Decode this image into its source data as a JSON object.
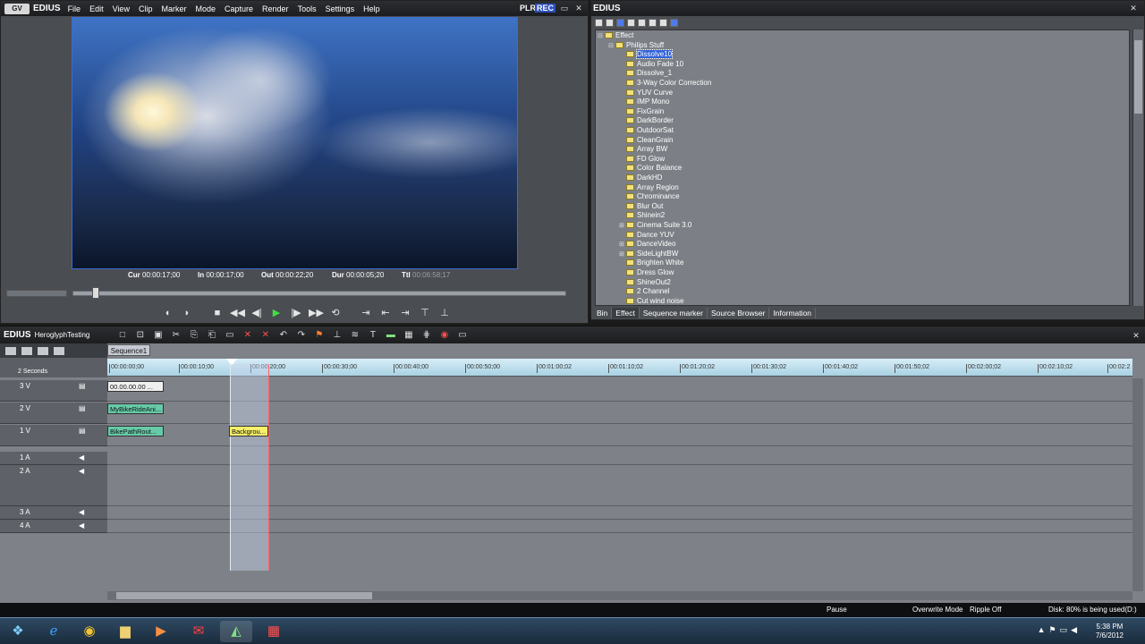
{
  "player": {
    "app_name": "EDIUS",
    "menu": [
      "File",
      "Edit",
      "View",
      "Clip",
      "Marker",
      "Mode",
      "Capture",
      "Render",
      "Tools",
      "Settings",
      "Help"
    ],
    "plr": "PLR",
    "rec": "REC",
    "timecodes": {
      "cur_label": "Cur",
      "cur": "00:00:17;00",
      "in_label": "In",
      "in": "00:00:17;00",
      "out_label": "Out",
      "out": "00:00:22;20",
      "dur_label": "Dur",
      "dur": "00:00:05;20",
      "ttl_label": "Ttl",
      "ttl": "00:06:58;17"
    },
    "scrub_position": 0.04
  },
  "effect_panel": {
    "title": "EDIUS",
    "tree": [
      {
        "label": "Effect",
        "level": 0,
        "expander": "minus"
      },
      {
        "label": "Philips Stuff",
        "level": 1,
        "expander": "minus"
      },
      {
        "label": "Dissolve10",
        "level": 2,
        "selected": true
      },
      {
        "label": "Audio Fade 10",
        "level": 2
      },
      {
        "label": "Dissolve_1",
        "level": 2
      },
      {
        "label": "3-Way Color Correction",
        "level": 2
      },
      {
        "label": "YUV Curve",
        "level": 2
      },
      {
        "label": "IMP Mono",
        "level": 2
      },
      {
        "label": "FixGrain",
        "level": 2
      },
      {
        "label": "DarkBorder",
        "level": 2
      },
      {
        "label": "OutdoorSat",
        "level": 2
      },
      {
        "label": "CleanGrain",
        "level": 2
      },
      {
        "label": "Array BW",
        "level": 2
      },
      {
        "label": "FD Glow",
        "level": 2
      },
      {
        "label": "Color Balance",
        "level": 2
      },
      {
        "label": "DarkHD",
        "level": 2
      },
      {
        "label": "Array Region",
        "level": 2
      },
      {
        "label": "Chrominance",
        "level": 2
      },
      {
        "label": "Blur Out",
        "level": 2
      },
      {
        "label": "Shinein2",
        "level": 2
      },
      {
        "label": "Cinema Suite 3.0",
        "level": 2,
        "expander": "plus"
      },
      {
        "label": "Dance YUV",
        "level": 2
      },
      {
        "label": "DanceVideo",
        "level": 2,
        "expander": "plus"
      },
      {
        "label": "SideLightBW",
        "level": 2,
        "expander": "plus"
      },
      {
        "label": "Brighten White",
        "level": 2
      },
      {
        "label": "Dress Glow",
        "level": 2
      },
      {
        "label": "ShineOut2",
        "level": 2
      },
      {
        "label": "2 Channel",
        "level": 2
      },
      {
        "label": "Cut wind noise",
        "level": 2
      }
    ],
    "tabs": [
      "Bin",
      "Effect",
      "Sequence marker",
      "Source Browser",
      "Information"
    ],
    "active_tab": "Effect"
  },
  "timeline": {
    "app_name": "EDIUS",
    "project": "HeroglyphTesting",
    "sequence_tab": "Sequence1",
    "scale": "2 Seconds",
    "ruler": [
      "00:00:00;00",
      "00:00:10;00",
      "00:00:20;00",
      "00:00:30;00",
      "00:00:40;00",
      "00:00:50;00",
      "00:01:00;02",
      "00:01:10;02",
      "00:01:20;02",
      "00:01:30;02",
      "00:01:40;02",
      "00:01:50;02",
      "00:02:00;02",
      "00:02:10;02",
      "00:02:2"
    ],
    "ruler_displayed": [
      "00:00:00;00",
      "00:00:10;00",
      "00:0",
      "0;00",
      "00:00:30;00",
      "00:00:40;00",
      "00:00:50;00",
      "00:01:00;02",
      "00:01:10;02",
      "00:01:20;02",
      "00:01:30;02",
      "00:01:40;02",
      "00:01:50;02",
      "00:02:00;02",
      "00:02:10;02",
      "00:02:2"
    ],
    "tracks": [
      {
        "name": "3 V"
      },
      {
        "name": "2 V"
      },
      {
        "name": "1 V"
      },
      {
        "name": "1 A"
      },
      {
        "name": "2 A"
      },
      {
        "name": "3 A"
      },
      {
        "name": "4 A"
      }
    ],
    "clips": {
      "v3": "00.00.00.00 ...",
      "v2": "MyBikeRideAni...",
      "v1": "BikePathRout...",
      "v1b": "Backgrou..."
    }
  },
  "status": {
    "mode": "Pause",
    "overwrite": "Overwrite Mode",
    "ripple": "Ripple Off",
    "disk": "Disk: 80% is being used(D:)"
  },
  "taskbar": {
    "time": "5:38 PM",
    "date": "7/6/2012"
  },
  "colors": {
    "accent": "#3162d8",
    "rec": "#2d4fbf",
    "play": "#3fe03f",
    "clip_green": "#67c9a8",
    "clip_yellow": "#f6ef6a"
  }
}
